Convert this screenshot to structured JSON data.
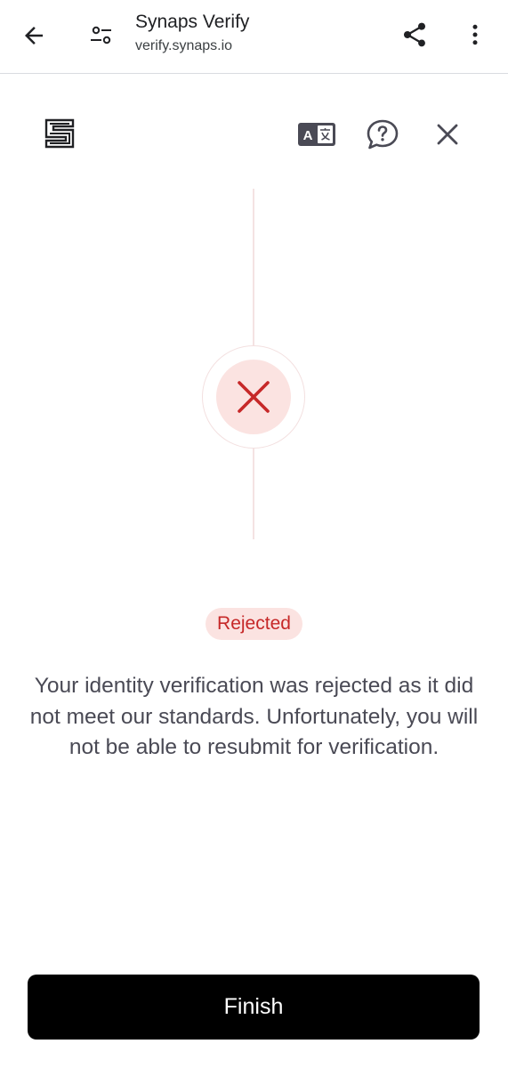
{
  "browser": {
    "title": "Synaps Verify",
    "url": "verify.synaps.io",
    "icons": [
      "back-arrow-icon",
      "tune-icon",
      "share-icon",
      "more-vert-icon"
    ]
  },
  "app_header": {
    "icons": [
      "synaps-logo-icon",
      "translate-icon",
      "help-chat-icon",
      "close-icon"
    ]
  },
  "status": {
    "icon": "x-mark-icon",
    "badge": "Rejected",
    "message": "Your identity verification was rejected as it did not meet our standards. Unfortunately, you will not be able to resubmit for verification."
  },
  "actions": {
    "finish_label": "Finish"
  },
  "colors": {
    "reject_red": "#c62828",
    "reject_bg": "#fbe3e1",
    "button_bg": "#000000",
    "text_gray": "#4a4a55"
  }
}
